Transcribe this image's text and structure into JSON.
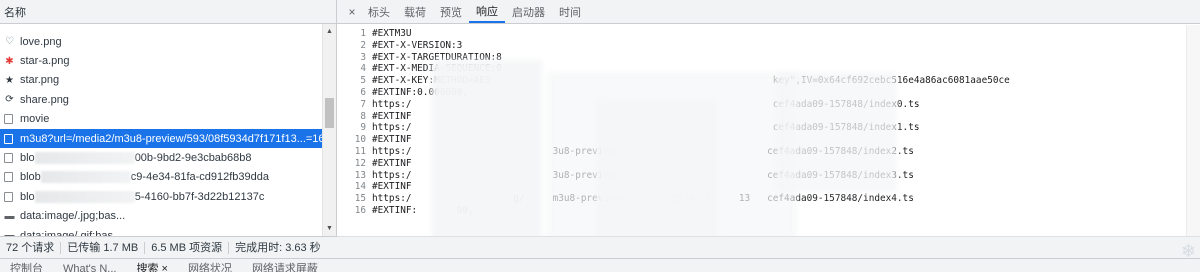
{
  "left_panel": {
    "header": "名称",
    "files": [
      {
        "name": "love.png",
        "icon": "heart-outline-icon",
        "glyph": "♡"
      },
      {
        "name": "star-a.png",
        "icon": "star-red-icon",
        "glyph": "✱"
      },
      {
        "name": "star.png",
        "icon": "star-icon",
        "glyph": "★"
      },
      {
        "name": "share.png",
        "icon": "share-icon",
        "glyph": "⟳"
      },
      {
        "name": "movie",
        "icon": "doc-icon"
      },
      {
        "name": "m3u8?url=/media2/m3u8-preview/593/08f5934d7f171f13...=16",
        "icon": "doc-icon",
        "selected": true
      },
      {
        "name": "blo",
        "suffix": "00b-9bd2-9e3cbab68b8",
        "icon": "doc-icon"
      },
      {
        "name": "blob",
        "suffix": "c9-4e34-81fa-cd912fb39dda",
        "icon": "doc-icon"
      },
      {
        "name": "blo",
        "suffix": "5-4160-bb7f-3d22b12137c",
        "icon": "doc-icon"
      },
      {
        "name": "data:image/.jpg;bas...",
        "icon": "image-icon",
        "glyph": "▬"
      },
      {
        "name": "data:image/.gif;bas...",
        "icon": "image-icon",
        "glyph": "▬"
      }
    ],
    "status": {
      "requests": "72 个请求",
      "transferred": "已传输 1.7 MB",
      "resources": "6.5 MB 项资源",
      "finish": "完成用时: 3.63 秒"
    }
  },
  "tabs": {
    "close": "×",
    "items": [
      "标头",
      "载荷",
      "预览",
      "响应",
      "启动器",
      "时间"
    ],
    "active": "响应"
  },
  "response_lines": [
    {
      "n": "1",
      "t": "#EXTM3U"
    },
    {
      "n": "2",
      "t": "#EXT-X-VERSION:3"
    },
    {
      "n": "3",
      "t": "#EXT-X-TARGETDURATION:8"
    },
    {
      "n": "4",
      "t": "#EXT-X-MEDIA-SEQUENCE:0"
    },
    {
      "n": "5",
      "t": "#EXT-X-KEY:METHOD=AES                                                  key\",IV=0x64cf692cebc516e4a86ac6081aae50ce"
    },
    {
      "n": "6",
      "t": "#EXTINF:0.000000,"
    },
    {
      "n": "7",
      "t": "https:/                                                                cef4ada09-157848/index0.ts"
    },
    {
      "n": "8",
      "t": "#EXTINF"
    },
    {
      "n": "9",
      "t": "https:/                                                                cef4ada09-157848/index1.ts"
    },
    {
      "n": "10",
      "t": "#EXTINF"
    },
    {
      "n": "11",
      "t": "https:/                         3u8-preview                           cef4ada09-157848/index2.ts"
    },
    {
      "n": "12",
      "t": "#EXTINF"
    },
    {
      "n": "13",
      "t": "https:/                         3u8-preview                           cef4ada09-157848/index3.ts"
    },
    {
      "n": "14",
      "t": "#EXTINF"
    },
    {
      "n": "15",
      "t": "https:/                  g/     m3u8-preview         5934d7f     13   cef4ada09-157848/index4.ts"
    },
    {
      "n": "16",
      "t": "#EXTINF:       00,"
    }
  ],
  "drawer": {
    "tabs": [
      "控制台",
      "What's N...",
      "搜索 ×",
      "网络状况",
      "网络请求屏蔽"
    ],
    "active": "搜索 ×"
  },
  "colors": {
    "accent": "#1a73e8",
    "panel": "#f1f3f4"
  }
}
